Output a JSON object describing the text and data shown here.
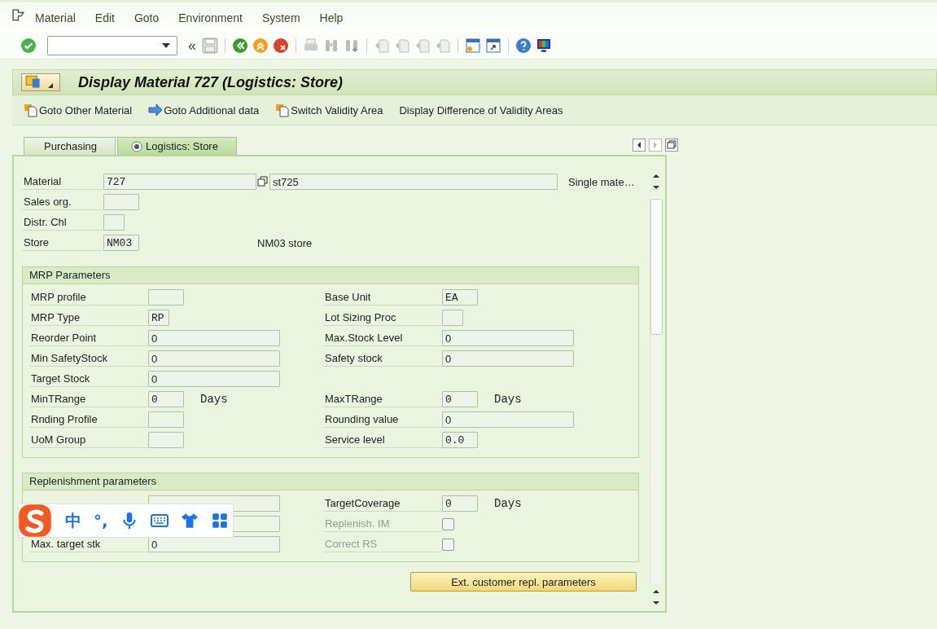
{
  "menu": [
    {
      "label": "Material"
    },
    {
      "label": "Edit"
    },
    {
      "label": "Goto"
    },
    {
      "label": "Environment"
    },
    {
      "label": "System"
    },
    {
      "label": "Help"
    }
  ],
  "toolbar": {
    "back_label": "«"
  },
  "title": "Display Material 727 (Logistics: Store)",
  "app_toolbar": [
    {
      "label": "Goto Other Material",
      "kind": "other"
    },
    {
      "label": "Goto Additional data",
      "kind": "arrow"
    },
    {
      "label": "Switch Validity Area",
      "kind": "other"
    },
    {
      "label": "Display Difference of Validity Areas",
      "kind": "none"
    }
  ],
  "tabs": [
    {
      "label": "Purchasing",
      "selected": false
    },
    {
      "label": "Logistics: Store",
      "selected": true
    }
  ],
  "header": {
    "material": {
      "label": "Material",
      "value": "727",
      "description": "st725",
      "note": "Single mate…"
    },
    "fields": [
      {
        "label": "Sales org.",
        "kind": "short"
      },
      {
        "label": "Distr. Chl",
        "kind": "tiny"
      },
      {
        "label": "Store",
        "value": "NM03",
        "kind": "short",
        "description": "NM03 store"
      }
    ]
  },
  "mrp": {
    "title": "MRP Parameters",
    "rows": [
      [
        {
          "label": "MRP profile",
          "kind": "short"
        },
        {
          "label": "Base Unit",
          "value": "EA",
          "kind": "short"
        }
      ],
      [
        {
          "label": "MRP Type",
          "value": "RP",
          "kind": "tiny"
        },
        {
          "label": "Lot Sizing Proc",
          "kind": "tiny"
        }
      ],
      [
        {
          "label": "Reorder Point",
          "value": "0",
          "kind": "long"
        },
        {
          "label": "Max.Stock Level",
          "value": "0",
          "kind": "long"
        }
      ],
      [
        {
          "label": "Min SafetyStock",
          "value": "0",
          "kind": "long"
        },
        {
          "label": "Safety stock",
          "value": "0",
          "kind": "long"
        }
      ],
      [
        {
          "label": "Target Stock",
          "value": "0",
          "kind": "long"
        }
      ],
      [
        {
          "label": "MinTRange",
          "value": "0",
          "kind": "short",
          "unit": "Days"
        },
        {
          "label": "MaxTRange",
          "value": "0",
          "kind": "short",
          "unit": "Days"
        }
      ],
      [
        {
          "label": "Rnding Profile",
          "kind": "short"
        },
        {
          "label": "Rounding value",
          "value": "0",
          "kind": "long"
        }
      ],
      [
        {
          "label": "UoM Group",
          "kind": "short"
        },
        {
          "label": "Service level",
          "value": "0.0",
          "kind": "short"
        }
      ]
    ]
  },
  "replenishment": {
    "title": "Replenishment parameters",
    "rows": [
      [
        {
          "kind": "long"
        },
        {
          "label": "TargetCoverage",
          "value": "0",
          "kind": "short",
          "unit": "Days"
        }
      ],
      [
        {
          "kind": "long"
        },
        {
          "label": "Replenish. IM",
          "kind": "checkbox",
          "checked": false,
          "disabled": true
        }
      ],
      [
        {
          "label": "Max. target stk",
          "value": "0",
          "kind": "long"
        },
        {
          "label": "Correct RS",
          "kind": "checkbox",
          "checked": false,
          "disabled": true
        }
      ]
    ]
  },
  "ext_button": {
    "label": "Ext. customer repl. parameters"
  },
  "ime_bar": {
    "language": "中",
    "punctuation": "°,"
  }
}
